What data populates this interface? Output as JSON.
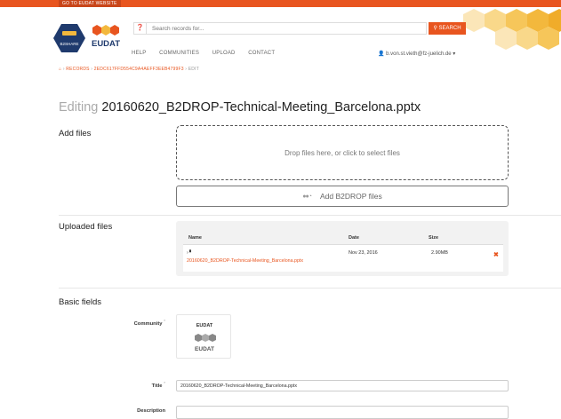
{
  "topbar": {
    "link": "GO TO EUDAT WEBSITE",
    "accent": "#e8551f"
  },
  "logo": {
    "b2share": "B2SHARE",
    "eudat": "EUDAT"
  },
  "search": {
    "placeholder": "Search records for...",
    "button": "SEARCH",
    "button_icon": "search-icon"
  },
  "nav": {
    "items": [
      "HELP",
      "COMMUNITIES",
      "UPLOAD",
      "CONTACT"
    ]
  },
  "user": {
    "icon": "user-icon",
    "email": "b.von.st.vieth@fz-juelich.de"
  },
  "breadcrumb": {
    "home_icon": "home-icon",
    "records": "RECORDS",
    "record_id": "2EDC617FFD554C9A4AEFF3EEB4799F3",
    "current": "EDIT",
    "sep": "›"
  },
  "title": {
    "prefix": "Editing",
    "filename": "20160620_B2DROP-Technical-Meeting_Barcelona.pptx"
  },
  "add_files": {
    "label": "Add files",
    "drop_text": "Drop files here, or click to select files",
    "b2drop_button": "Add B2DROP files"
  },
  "uploaded": {
    "label": "Uploaded files",
    "columns": [
      "Name",
      "Date",
      "Size"
    ],
    "rows": [
      {
        "name": "20160620_B2DROP-Technical-Meeting_Barcelona.pptx",
        "date": "Nov 23, 2016",
        "size": "2.90MB"
      }
    ]
  },
  "basic": {
    "label": "Basic fields",
    "community_label": "Community",
    "community_name": "EUDAT",
    "community_logo_text": "EUDAT",
    "title_label": "Title",
    "title_value": "20160620_B2DROP-Technical-Meeting_Barcelona.pptx",
    "description_label": "Description",
    "required_mark": "*"
  }
}
